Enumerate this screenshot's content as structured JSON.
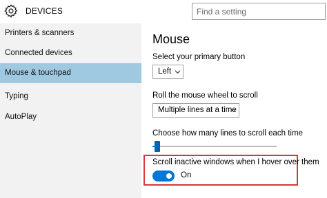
{
  "header": {
    "title": "DEVICES",
    "icon": "gear-icon",
    "search_placeholder": "Find a setting"
  },
  "sidebar": {
    "items": [
      {
        "label": "Printers & scanners",
        "active": false
      },
      {
        "label": "Connected devices",
        "active": false
      },
      {
        "label": "Mouse & touchpad",
        "active": true
      },
      {
        "label": "Typing",
        "active": false
      },
      {
        "label": "AutoPlay",
        "active": false
      }
    ],
    "active_color": "#9fc9e0"
  },
  "main": {
    "heading": "Mouse",
    "primary_button": {
      "label": "Select your primary button",
      "value": "Left"
    },
    "scroll_wheel": {
      "label": "Roll the mouse wheel to scroll",
      "value": "Multiple lines at a time"
    },
    "lines_to_scroll": {
      "label": "Choose how many lines to scroll each time",
      "level": 0.03
    },
    "scroll_inactive": {
      "label": "Scroll inactive windows when I hover over them",
      "state": "On",
      "toggle_on": true
    }
  },
  "colors": {
    "accent": "#0078d7",
    "highlight_border": "#d9363e"
  }
}
